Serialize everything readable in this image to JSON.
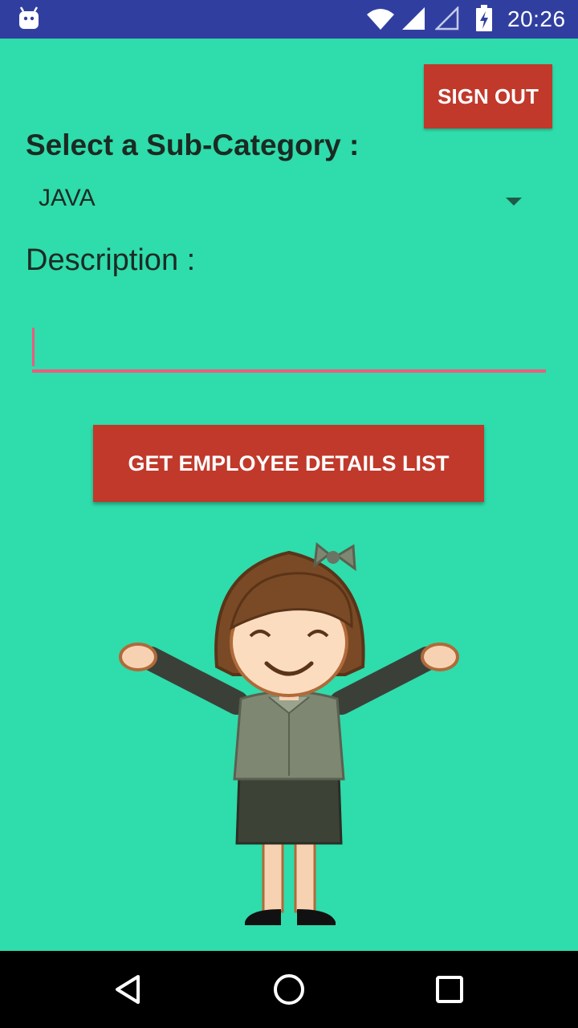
{
  "status_bar": {
    "time": "20:26",
    "icons": [
      "android-icon",
      "wifi-icon",
      "signal-icon",
      "signal-empty-icon",
      "battery-icon"
    ],
    "background_color": "#303f9f"
  },
  "header": {
    "sign_out_label": "SIGN OUT"
  },
  "form": {
    "sub_category_label": "Select a Sub-Category :",
    "selected_sub_category": "JAVA",
    "description_label": "Description :",
    "description_value": ""
  },
  "actions": {
    "get_employee_label": "GET EMPLOYEE DETAILS LIST"
  },
  "illustration": {
    "subject": "cartoon woman with open arms"
  },
  "nav_bar": {
    "icons": [
      "back-icon",
      "home-icon",
      "recents-icon"
    ]
  },
  "colors": {
    "background": "#2fdcab",
    "button": "#c0392b",
    "accent": "#ee5a80",
    "status_bar": "#303f9f"
  }
}
